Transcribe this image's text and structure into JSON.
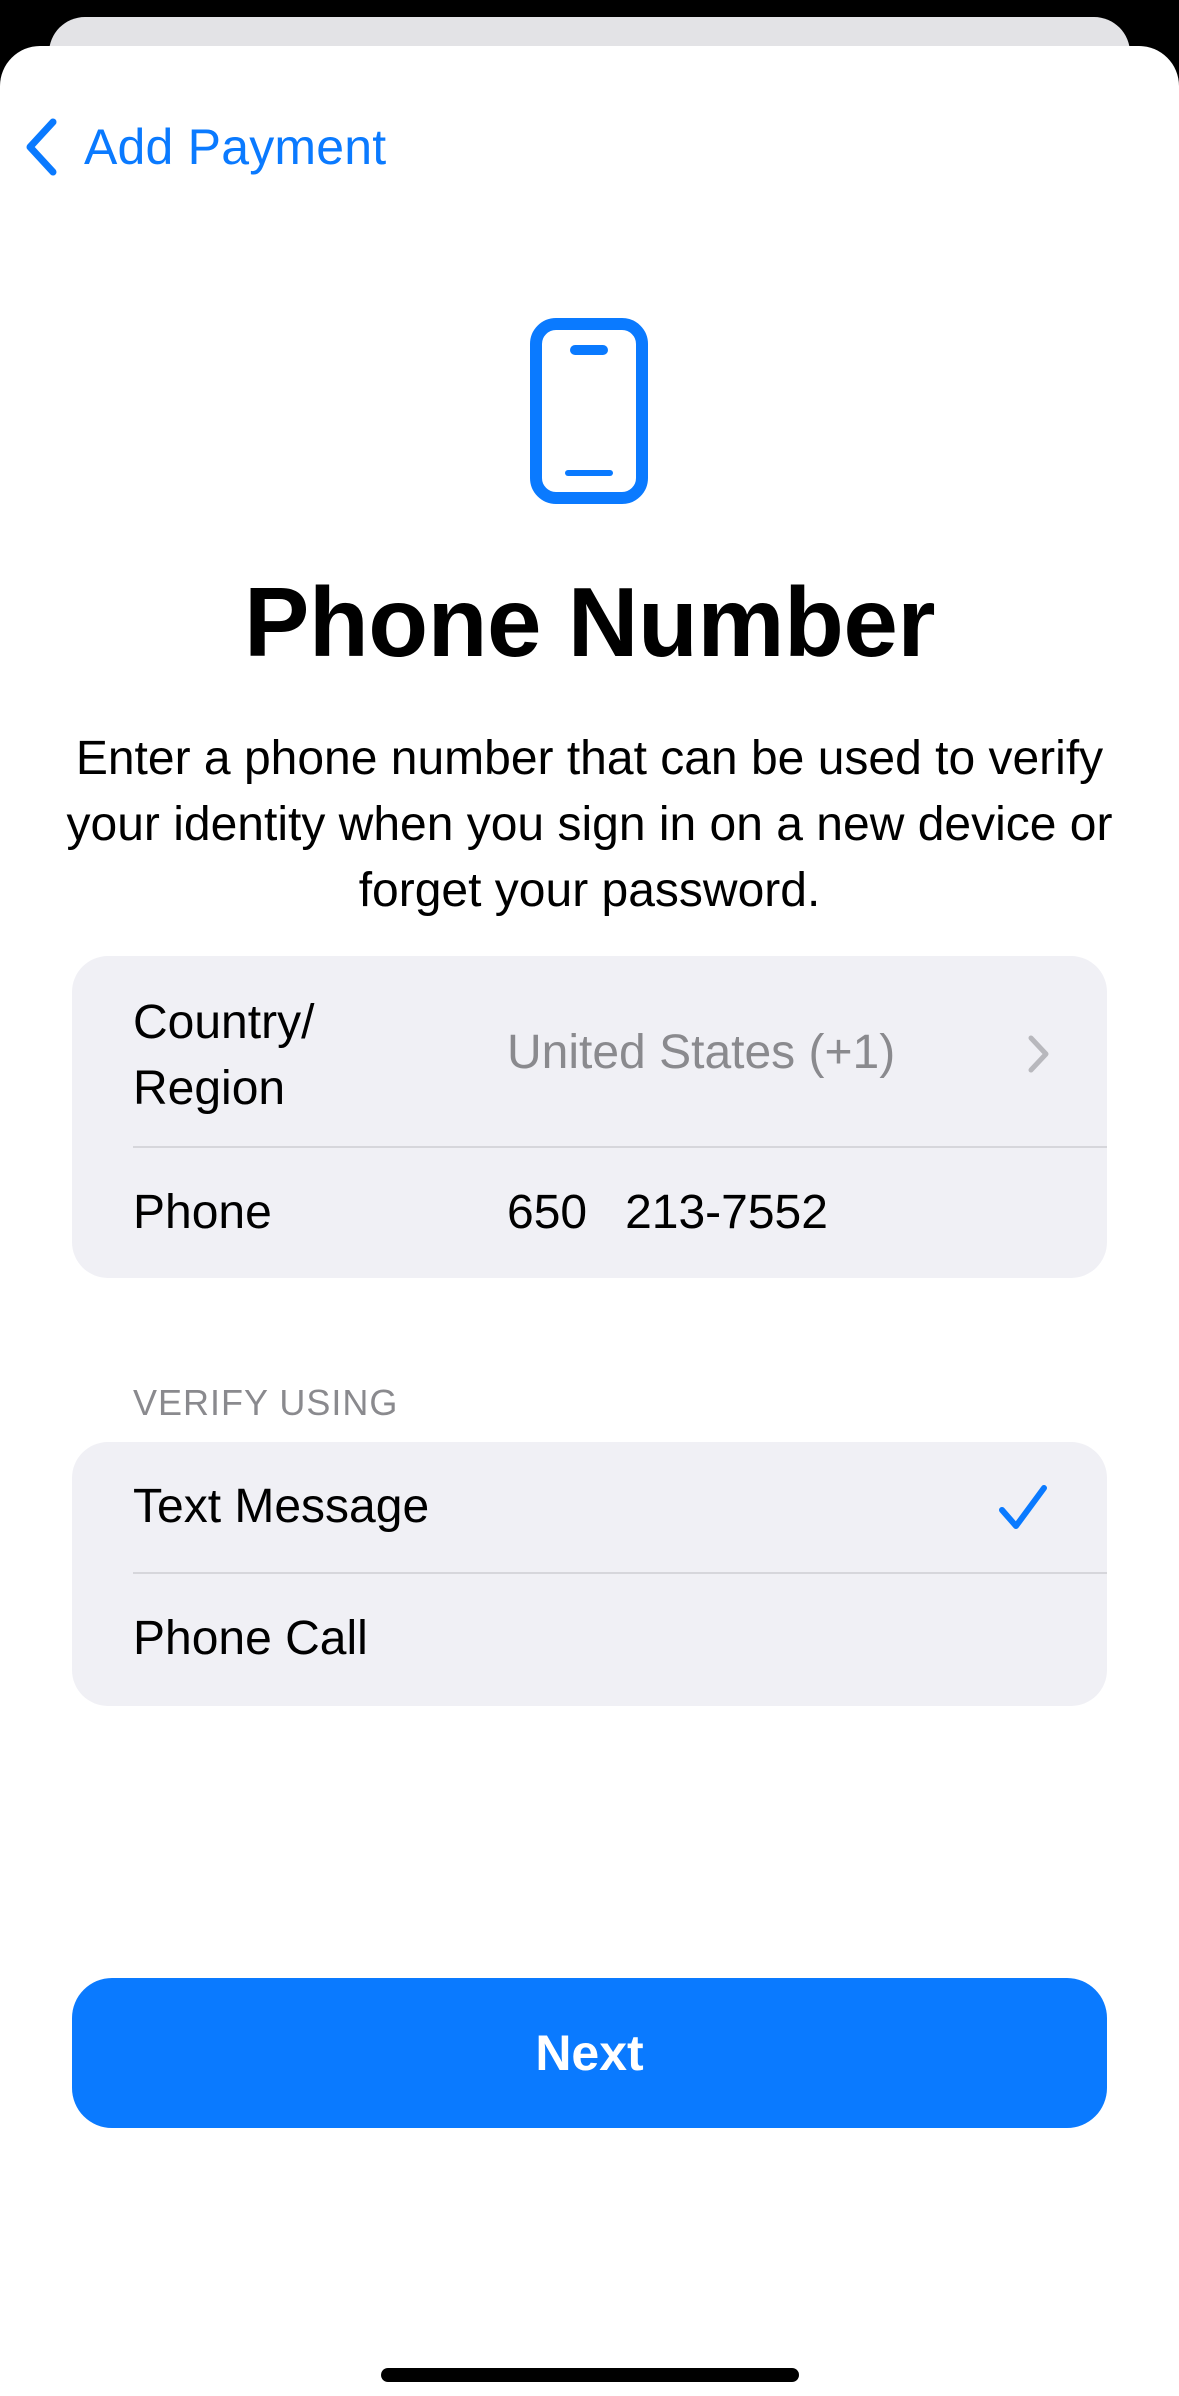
{
  "nav": {
    "back_label": "Add Payment"
  },
  "icons": {
    "back": "chevron-left-icon",
    "hero": "iphone-icon",
    "disclosure": "chevron-right-icon",
    "selected": "checkmark-icon"
  },
  "page": {
    "title": "Phone Number",
    "description": "Enter a phone number that can be used to verify your identity when you sign in on a new device or forget your password."
  },
  "form": {
    "country_label_line1": "Country/",
    "country_label_line2": "Region",
    "country_value": "United States (+1)",
    "phone_label": "Phone",
    "phone_area": "650",
    "phone_number": "213-7552"
  },
  "verify": {
    "header": "VERIFY USING",
    "options": [
      {
        "label": "Text Message",
        "selected": true
      },
      {
        "label": "Phone Call",
        "selected": false
      }
    ]
  },
  "actions": {
    "next_label": "Next"
  },
  "colors": {
    "accent": "#0A7AFF",
    "grouped_background": "#F0F0F5",
    "secondary_text": "#8A8A8E",
    "separator": "#D6D6DB"
  }
}
